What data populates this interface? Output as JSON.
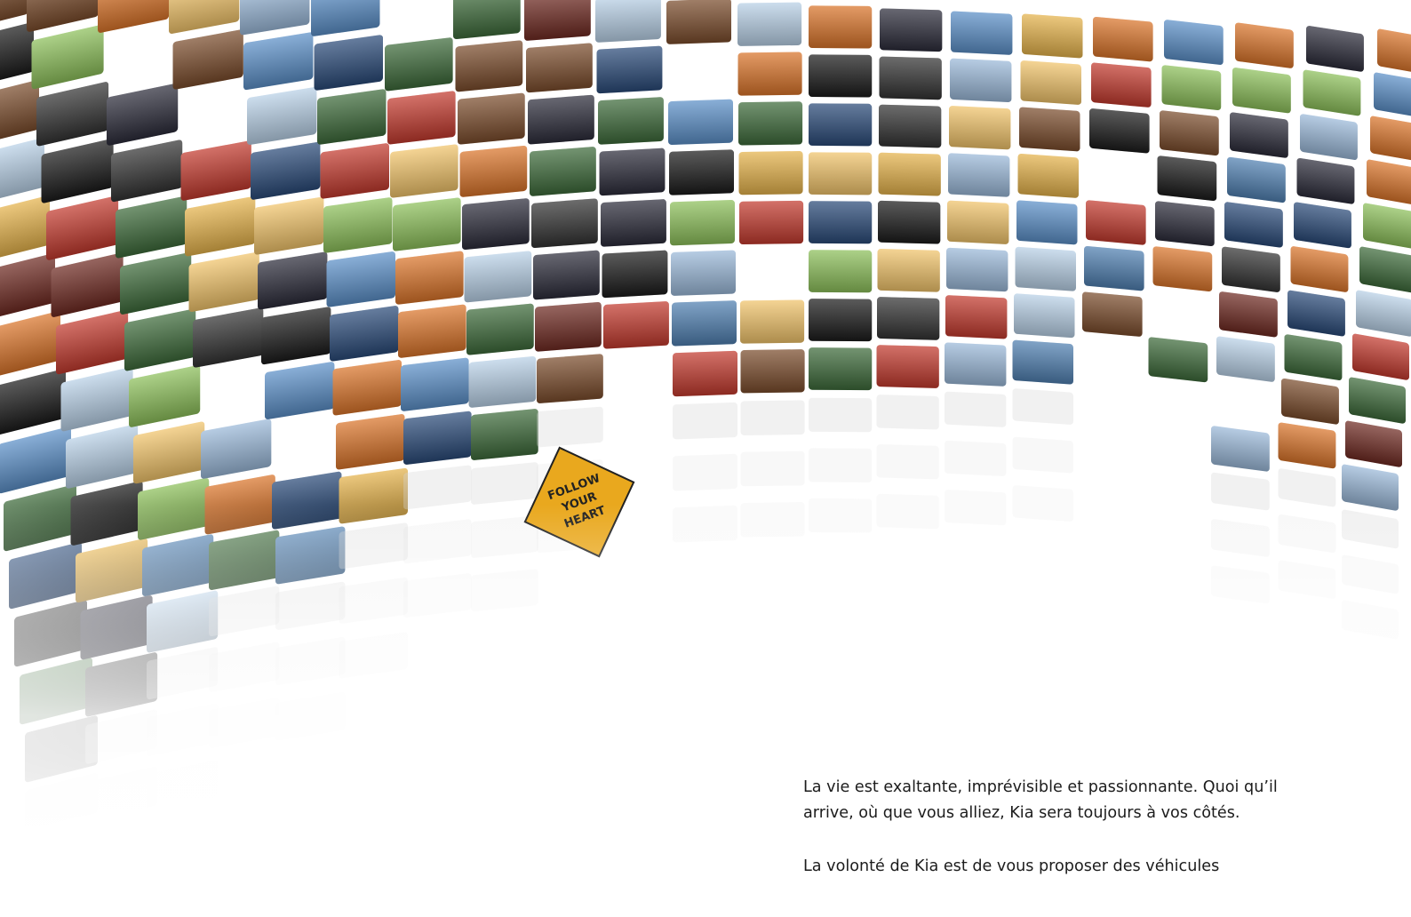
{
  "text": {
    "paragraph_1": "La vie est exaltante, imprévisible et passionnante. Quoi qu’il arrive, où que vous alliez, Kia sera toujours à vos côtés.",
    "paragraph_2": "La volonté de Kia est de vous proposer des véhicules"
  },
  "mosaic": {
    "signs": [
      "FOLLOW",
      "YOUR",
      "HEART"
    ],
    "palette": [
      "#2a4a78",
      "#d9742a",
      "#5b8fc7",
      "#1b1b1b",
      "#8cbf5a",
      "#c23a2e",
      "#e4b24b",
      "#3d6a3a",
      "#7a4c2c",
      "#9ab8d8",
      "#2c2c3a",
      "#f0c36a",
      "#6e2a22",
      "#4f7fb0",
      "#b8d0e6",
      "#333333"
    ]
  }
}
